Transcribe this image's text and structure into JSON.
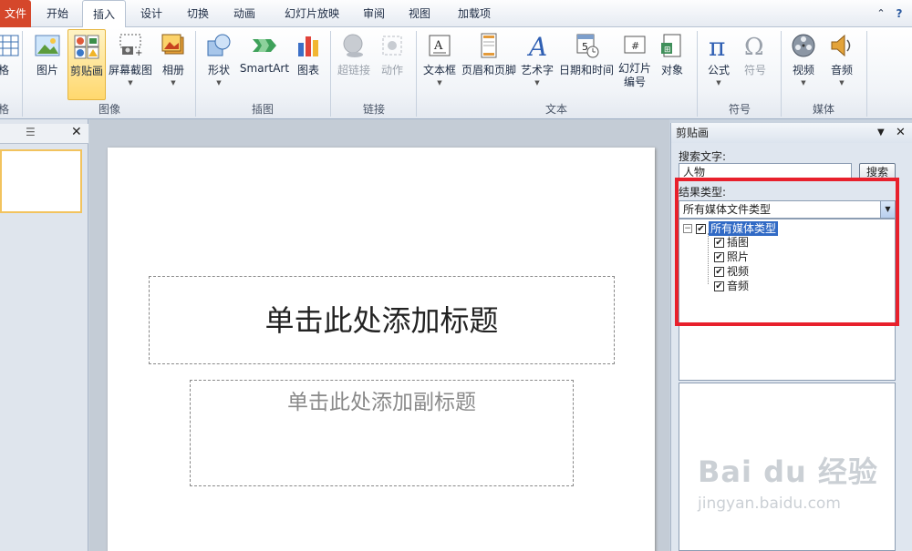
{
  "tabs": [
    "文件",
    "开始",
    "插入",
    "设计",
    "切换",
    "动画",
    "幻灯片放映",
    "审阅",
    "视图",
    "加载项"
  ],
  "ribbon": {
    "table_label": "格",
    "table_group": "格",
    "buttons": {
      "picture": "图片",
      "clipart": "剪贴画",
      "screenshot": "屏幕截图",
      "album": "相册",
      "shapes": "形状",
      "smartart": "SmartArt",
      "chart": "图表",
      "hyperlink": "超链接",
      "action": "动作",
      "textbox": "文本框",
      "header_footer": "页眉和页脚",
      "wordart": "艺术字",
      "datetime": "日期和时间",
      "slide_number_1": "幻灯片",
      "slide_number_2": "编号",
      "object": "对象",
      "equation": "公式",
      "symbol": "符号",
      "video": "视频",
      "audio": "音频"
    },
    "groups": {
      "images": "图像",
      "illustrations": "插图",
      "links": "链接",
      "text": "文本",
      "symbols": "符号",
      "media": "媒体"
    }
  },
  "slide": {
    "title_placeholder": "单击此处添加标题",
    "subtitle_placeholder": "单击此处添加副标题"
  },
  "clipart_pane": {
    "title": "剪贴画",
    "search_label": "搜索文字:",
    "search_value": "人物",
    "search_button": "搜索",
    "results_label": "结果类型:",
    "results_selected": "所有媒体文件类型",
    "tree_root": "所有媒体类型",
    "tree_items": [
      "插图",
      "照片",
      "视频",
      "音频"
    ]
  },
  "watermark": {
    "brand": "Bai du 经验",
    "url": "jingyan.baidu.com"
  },
  "colors": {
    "file_tab": "#d5472b",
    "highlight_box": "#e8202c",
    "selected_button": "#ffd86e"
  }
}
